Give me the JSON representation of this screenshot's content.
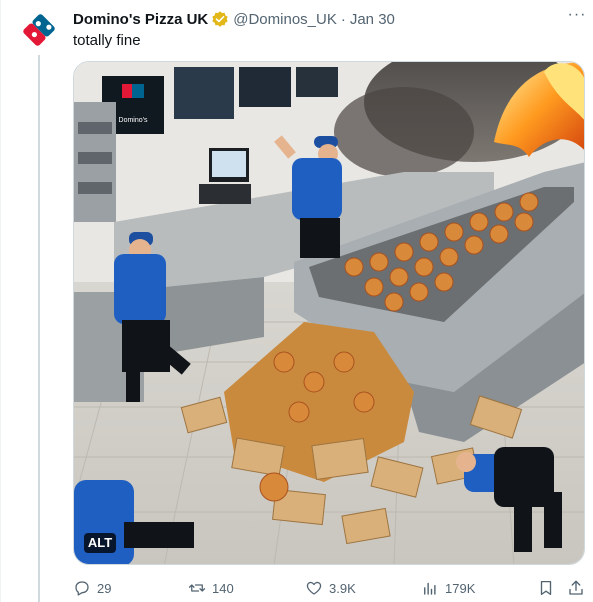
{
  "post": {
    "author_name": "Domino's Pizza UK",
    "handle": "@Dominos_UK",
    "separator": "·",
    "date": "Jan 30",
    "text": "totally fine",
    "more_label": "···",
    "media": {
      "alt_label": "ALT",
      "sign_text": "Domino's"
    }
  },
  "actions": {
    "replies": "29",
    "reposts": "140",
    "likes": "3.9K",
    "views": "179K"
  },
  "colors": {
    "brand_red": "#e31837",
    "brand_blue": "#006491",
    "verified_gold": "#e2b719",
    "muted_text": "#536471"
  }
}
